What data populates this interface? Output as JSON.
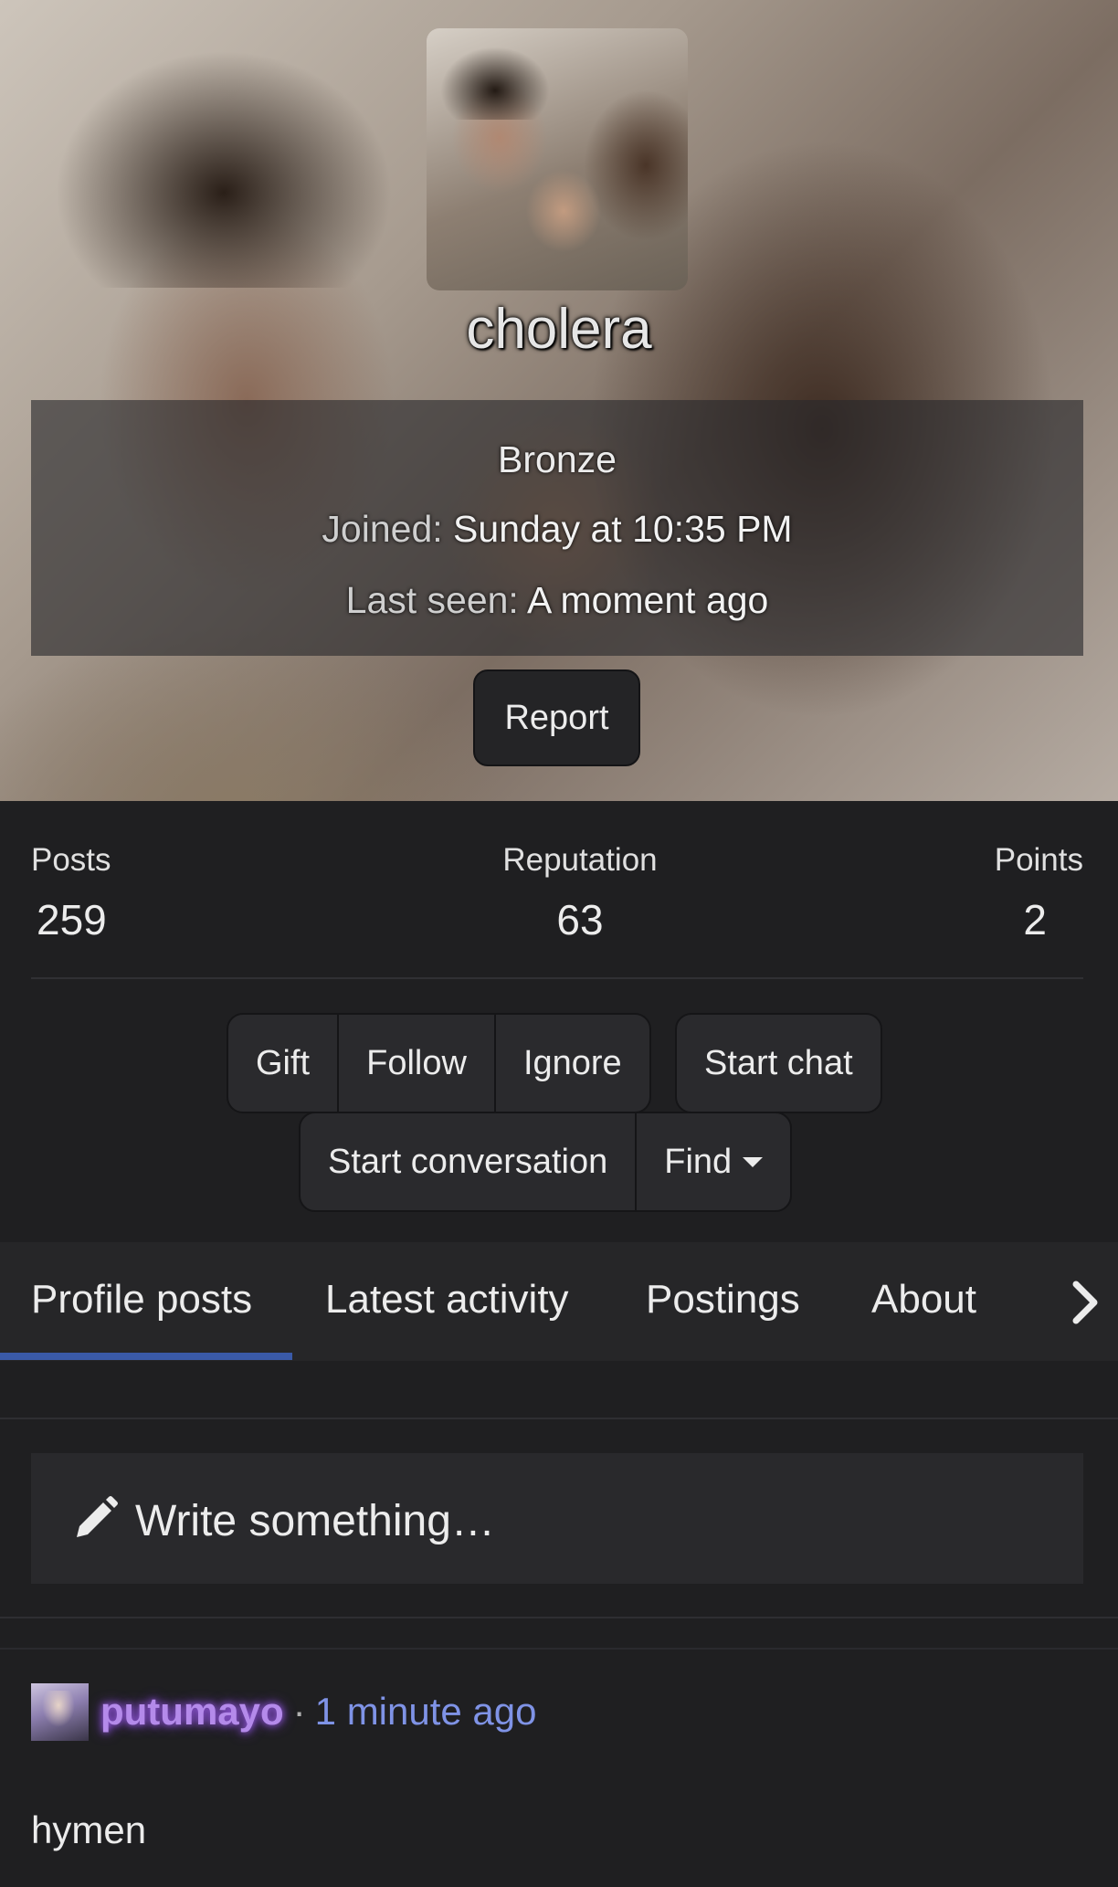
{
  "profile": {
    "username": "cholera",
    "rank": "Bronze",
    "joined_label": "Joined:",
    "joined_value": "Sunday at 10:35 PM",
    "last_seen_label": "Last seen:",
    "last_seen_value": "A moment ago",
    "report_label": "Report"
  },
  "stats": {
    "posts_label": "Posts",
    "posts_value": "259",
    "reputation_label": "Reputation",
    "reputation_value": "63",
    "points_label": "Points",
    "points_value": "2"
  },
  "actions": {
    "gift": "Gift",
    "follow": "Follow",
    "ignore": "Ignore",
    "start_chat": "Start chat",
    "start_conversation": "Start conversation",
    "find": "Find"
  },
  "tabs": [
    {
      "label": "Profile posts",
      "active": true
    },
    {
      "label": "Latest activity",
      "active": false
    },
    {
      "label": "Postings",
      "active": false
    },
    {
      "label": "About",
      "active": false
    }
  ],
  "composer": {
    "placeholder": "Write something…",
    "icon": "pencil-icon"
  },
  "post": {
    "author": "putumayo",
    "separator": "·",
    "time": "1 minute ago",
    "body": "hymen"
  },
  "colors": {
    "background": "#1f1f21",
    "accent_underline": "#3a5aa8",
    "author_purple": "#b48aea",
    "time_blue": "#7f93e6"
  }
}
